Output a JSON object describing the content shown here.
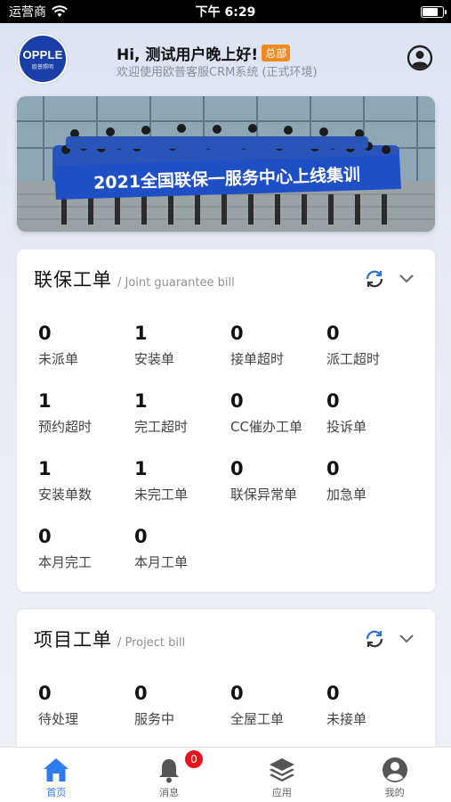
{
  "status_bar": {
    "carrier": "运营商",
    "time": "下午 6:29"
  },
  "header": {
    "logo_brand": "OPPLE",
    "logo_sub": "欧普照明",
    "greeting": "Hi, 测试用户晚上好!",
    "badge": "总部",
    "welcome": "欢迎使用欧普客服CRM系统 (正式环境)"
  },
  "banner": {
    "text": "2021全国联保一服务中心上线集训"
  },
  "joint_card": {
    "title": "联保工单",
    "subtitle": "/ Joint guarantee bill",
    "items": [
      {
        "value": "0",
        "label": "未派单"
      },
      {
        "value": "1",
        "label": "安装单"
      },
      {
        "value": "0",
        "label": "接单超时"
      },
      {
        "value": "0",
        "label": "派工超时"
      },
      {
        "value": "1",
        "label": "预约超时"
      },
      {
        "value": "1",
        "label": "完工超时"
      },
      {
        "value": "0",
        "label": "CC催办工单"
      },
      {
        "value": "0",
        "label": "投诉单"
      },
      {
        "value": "1",
        "label": "安装单数"
      },
      {
        "value": "1",
        "label": "未完工单"
      },
      {
        "value": "0",
        "label": "联保异常单"
      },
      {
        "value": "0",
        "label": "加急单"
      },
      {
        "value": "0",
        "label": "本月完工"
      },
      {
        "value": "0",
        "label": "本月工单"
      }
    ]
  },
  "project_card": {
    "title": "项目工单",
    "subtitle": "/ Project bill",
    "items": [
      {
        "value": "0",
        "label": "待处理"
      },
      {
        "value": "0",
        "label": "服务中"
      },
      {
        "value": "0",
        "label": "全屋工单"
      },
      {
        "value": "0",
        "label": "未接单"
      }
    ]
  },
  "tabbar": {
    "home": "首页",
    "messages": "消息",
    "messages_badge": "0",
    "apps": "应用",
    "mine": "我的"
  },
  "colors": {
    "accent": "#2f7bf0",
    "badge_orange": "#f08a1e",
    "badge_red": "#e8141d",
    "logo_blue": "#1a3fa8"
  }
}
